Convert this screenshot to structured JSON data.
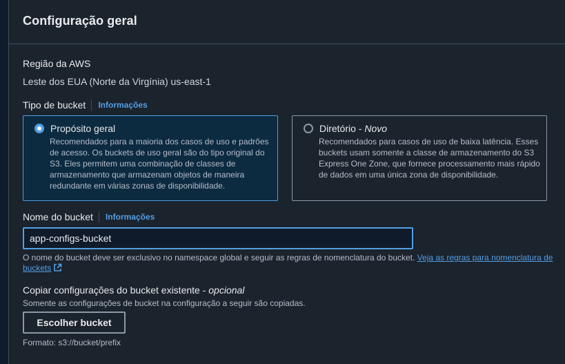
{
  "panel": {
    "title": "Configuração geral"
  },
  "region": {
    "label": "Região da AWS",
    "value": "Leste dos EUA (Norte da Virgínia) us-east-1"
  },
  "bucket_type": {
    "label": "Tipo de bucket",
    "info": "Informações",
    "selected": "general",
    "options": [
      {
        "title": "Propósito geral",
        "tag": "",
        "description": "Recomendados para a maioria dos casos de uso e padrões de acesso. Os buckets de uso geral são do tipo original do S3. Eles permitem uma combinação de classes de armazenamento que armazenam objetos de maneira redundante em várias zonas de disponibilidade."
      },
      {
        "title": "Diretório - ",
        "tag": "Novo",
        "description": "Recomendados para casos de uso de baixa latência. Esses buckets usam somente a classe de armazenamento do S3 Express One Zone, que fornece processamento mais rápido de dados em uma única zona de disponibilidade."
      }
    ]
  },
  "bucket_name": {
    "label": "Nome do bucket",
    "info": "Informações",
    "value": "app-configs-bucket",
    "constraint": "O nome do bucket deve ser exclusivo no namespace global e seguir as regras de nomenclatura do bucket. ",
    "rules_link": "Veja as regras para nomenclatura de buckets"
  },
  "copy_settings": {
    "label": "Copiar configurações do bucket existente - ",
    "optional": "opcional",
    "description": "Somente as configurações de bucket na configuração a seguir são copiadas.",
    "button": "Escolher bucket",
    "format_hint": "Formato: s3://bucket/prefix"
  },
  "colors": {
    "accent": "#539fe5",
    "panel_bg": "#1b232d",
    "selected_tile_bg": "#0c2a40"
  },
  "icons": {
    "rules_link": "external-link-icon"
  }
}
